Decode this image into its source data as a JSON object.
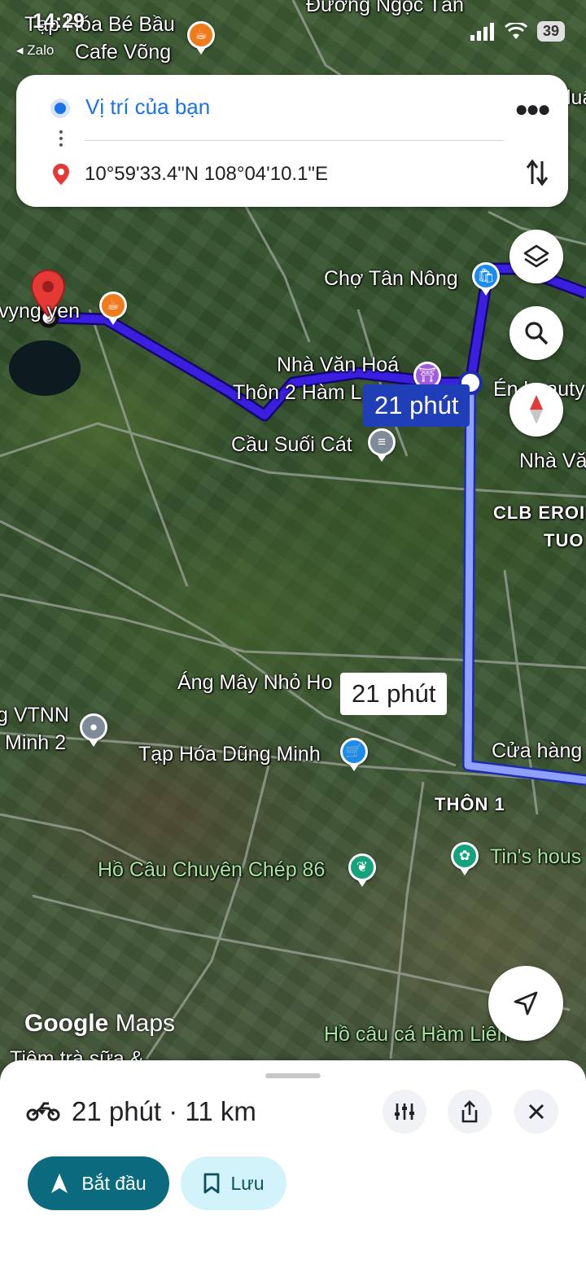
{
  "status_bar": {
    "time": "14:29",
    "back_app": "◂ Zalo",
    "battery": "39"
  },
  "directions": {
    "origin": "Vị trí của bạn",
    "destination": "10°59'33.4\"N 108°04'10.1\"E"
  },
  "map": {
    "labels": {
      "duong_ngoc_tan": "Đường Ngọc Tân",
      "tap_hoa_be_bau": "Tạp Hóa Bé Bầu",
      "cafe_vong": "Cafe Võng",
      "cho_tan_nong": "Chợ Tân Nông",
      "vyng_yen": "vyng yen",
      "nha_van_hoa_1": "Nhà Văn Hoá",
      "thon_2_ham_l": "Thôn 2 Hàm L",
      "en_beauty": "Én beauty",
      "cau_suoi_cat": "Cầu Suối Cát",
      "nha_van_right": "Nhà Vă",
      "clb_erob": "CLB EROI",
      "tuo": "TUO",
      "ang_may": "Áng Mây Nhỏ Ho",
      "vtnn": "g VTNN",
      "minh_2": "Minh 2",
      "tap_hoa_dung_minh": "Tạp Hóa Dũng Minh",
      "cua_hang": "Cửa hàng",
      "thon_1": "THÔN 1",
      "ho_cau_chuyen_chep": "Hồ Câu Chuyên Chép 86",
      "tins_house": "Tin's hous",
      "ho_cau_ca_ham_lien": "Hồ câu cá Hàm Liên",
      "tiem_tra_sua": "Tiệm trà sữa &",
      "luan": "luậ"
    },
    "route_primary_time": "21 phút",
    "route_alt_time": "21 phút",
    "logo_google": "Google",
    "logo_maps": "Maps"
  },
  "sheet": {
    "summary": "21 phút · 11 km",
    "start_label": "Bắt đầu",
    "save_label": "Lưu"
  },
  "colors": {
    "route_primary": "#3a1fe0",
    "route_alt": "#8fa0ff",
    "start_button": "#0b6a7d",
    "save_button": "#d3f3fb",
    "origin_blue": "#1a73e8",
    "dest_red": "#e53935"
  }
}
